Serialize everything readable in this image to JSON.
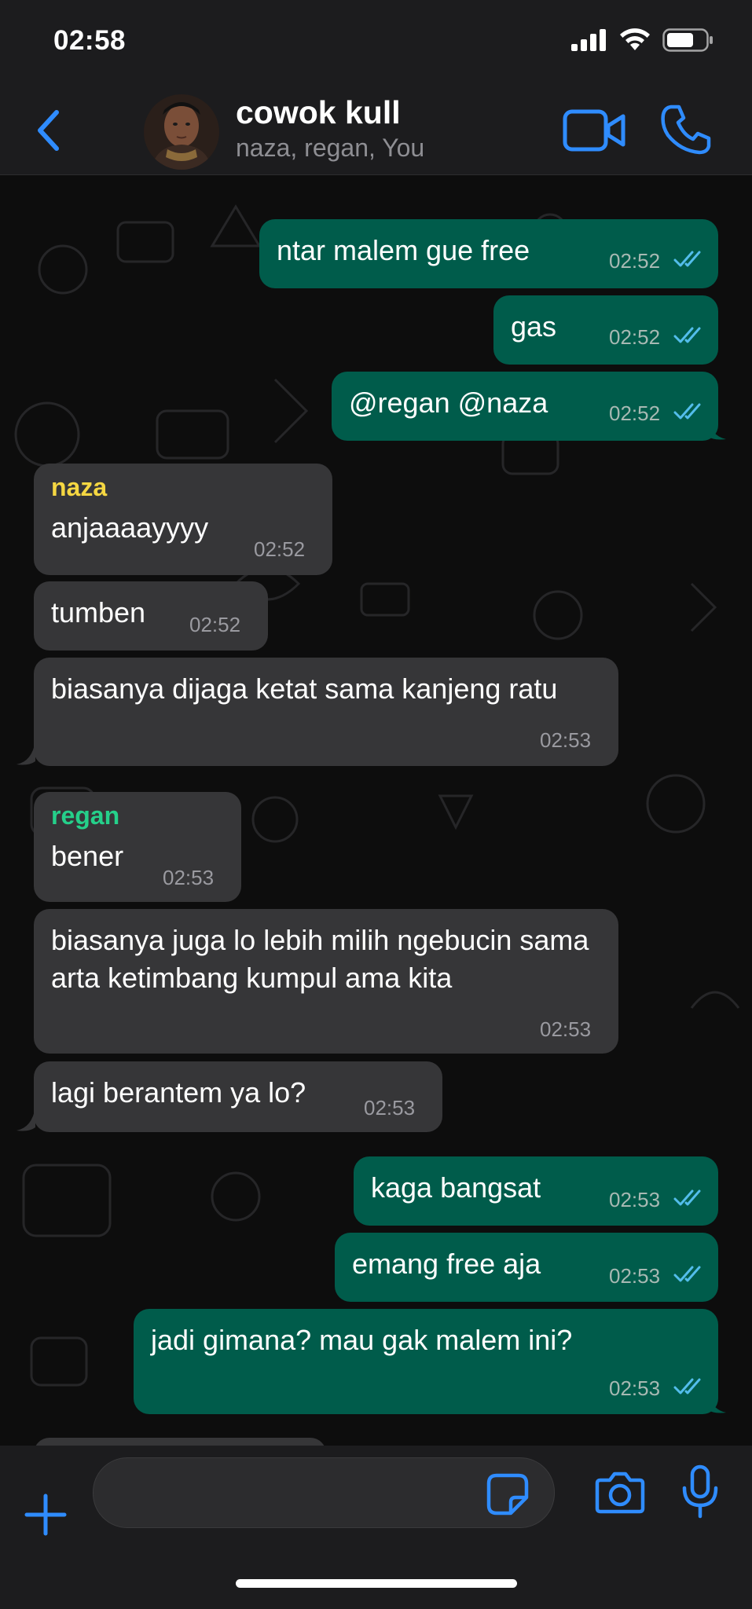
{
  "status_bar": {
    "time": "02:58",
    "battery_level": 0.7
  },
  "header": {
    "title": "cowok kull",
    "subtitle": "naza, regan, You",
    "back_icon": "chevron-left-icon",
    "video_icon": "video-camera-icon",
    "call_icon": "phone-icon"
  },
  "colors": {
    "accent": "#2f8cff",
    "outgoing_bubble": "#005c4b",
    "incoming_bubble": "#363638",
    "read_ticks": "#53bdeb",
    "sender_naza": "#f5d742",
    "sender_regan": "#25d08a"
  },
  "messages": [
    {
      "text": "ntar malem gue free",
      "time": "02:52",
      "direction": "out",
      "status": "read"
    },
    {
      "text": "gas",
      "time": "02:52",
      "direction": "out",
      "status": "read"
    },
    {
      "text": "@regan @naza",
      "time": "02:52",
      "direction": "out",
      "status": "read"
    },
    {
      "sender": "naza",
      "text": "anjaaaayyyy",
      "time": "02:52",
      "direction": "in"
    },
    {
      "text": "tumben",
      "time": "02:52",
      "direction": "in"
    },
    {
      "text": "biasanya dijaga ketat sama kanjeng ratu",
      "time": "02:53",
      "direction": "in"
    },
    {
      "sender": "regan",
      "text": "bener",
      "time": "02:53",
      "direction": "in"
    },
    {
      "text": "biasanya juga lo lebih milih ngebucin sama arta ketimbang kumpul ama kita",
      "time": "02:53",
      "direction": "in"
    },
    {
      "text": "lagi berantem ya lo?",
      "time": "02:53",
      "direction": "in"
    },
    {
      "text": "kaga bangsat",
      "time": "02:53",
      "direction": "out",
      "status": "read"
    },
    {
      "text": "emang free aja",
      "time": "02:53",
      "direction": "out",
      "status": "read"
    },
    {
      "text": "jadi gimana? mau gak malem ini?",
      "time": "02:53",
      "direction": "out",
      "status": "read"
    }
  ],
  "input_bar": {
    "plus_icon": "plus-icon",
    "sticker_icon": "sticker-icon",
    "camera_icon": "camera-icon",
    "mic_icon": "microphone-icon"
  }
}
